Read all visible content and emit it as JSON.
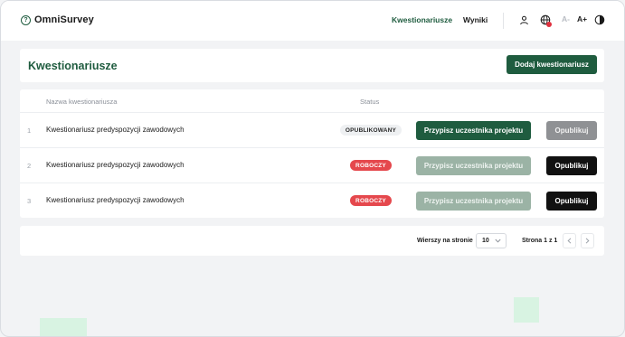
{
  "header": {
    "brand": "OmniSurvey",
    "brand_icon": "question-circle-icon",
    "nav": [
      {
        "label": "Kwestionariusze",
        "active": true
      },
      {
        "label": "Wyniki",
        "active": false
      }
    ],
    "icons": [
      "user-icon",
      "globe-icon",
      "contrast-icon"
    ],
    "font_decrease": "A-",
    "font_increase": "A+"
  },
  "page": {
    "title": "Kwestionariusze",
    "add_button": "Dodaj kwestionariusz"
  },
  "table": {
    "columns": {
      "name": "Nazwa kwestionariusza",
      "status": "Status"
    },
    "rows": [
      {
        "num": "1",
        "name": "Kwestionariusz predyspozycji zawodowych",
        "status": "OPUBLIKOWANY",
        "assign_label": "Przypisz uczestnika projektu",
        "assign_enabled": true,
        "publish_label": "Opublikuj",
        "publish_enabled": false
      },
      {
        "num": "2",
        "name": "Kwestionariusz predyspozycji zawodowych",
        "status": "ROBOCZY",
        "assign_label": "Przypisz uczestnika projektu",
        "assign_enabled": false,
        "publish_label": "Opublikuj",
        "publish_enabled": true
      },
      {
        "num": "3",
        "name": "Kwestionariusz predyspozycji zawodowych",
        "status": "ROBOCZY",
        "assign_label": "Przypisz uczestnika projektu",
        "assign_enabled": false,
        "publish_label": "Opublikuj",
        "publish_enabled": true
      }
    ]
  },
  "pagination": {
    "rows_per_page_label": "Wierszy na stronie",
    "rows_per_page_value": "10",
    "page_info": "Strona 1 z 1"
  },
  "colors": {
    "brand_green": "#1f5c3f",
    "draft_red": "#e5484d",
    "disabled_green": "#9bb3a5"
  }
}
